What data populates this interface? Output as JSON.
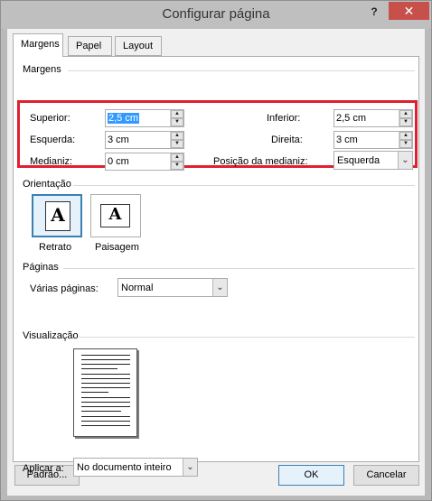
{
  "window": {
    "title": "Configurar página",
    "help_label": "?",
    "close_label": "✕"
  },
  "tabs": [
    {
      "label": "Margens"
    },
    {
      "label": "Papel"
    },
    {
      "label": "Layout"
    }
  ],
  "margins": {
    "section_label": "Margens",
    "top_label": "Superior:",
    "top_value": "2,5 cm",
    "bottom_label": "Inferior:",
    "bottom_value": "2,5 cm",
    "left_label": "Esquerda:",
    "left_value": "3 cm",
    "right_label": "Direita:",
    "right_value": "3 cm",
    "gutter_label": "Medianiz:",
    "gutter_value": "0 cm",
    "gutter_pos_label": "Posição da medianiz:",
    "gutter_pos_value": "Esquerda"
  },
  "orientation": {
    "section_label": "Orientação",
    "portrait_label": "Retrato",
    "landscape_label": "Paisagem",
    "selected": "portrait"
  },
  "pages": {
    "section_label": "Páginas",
    "multiple_label": "Várias páginas:",
    "multiple_value": "Normal"
  },
  "preview": {
    "section_label": "Visualização"
  },
  "apply": {
    "label": "Aplicar a:",
    "value": "No documento inteiro"
  },
  "buttons": {
    "default_label": "Padrão...",
    "ok_label": "OK",
    "cancel_label": "Cancelar"
  },
  "colors": {
    "highlight": "#e02030",
    "close_button": "#c7504b",
    "selection": "#3399ff"
  }
}
